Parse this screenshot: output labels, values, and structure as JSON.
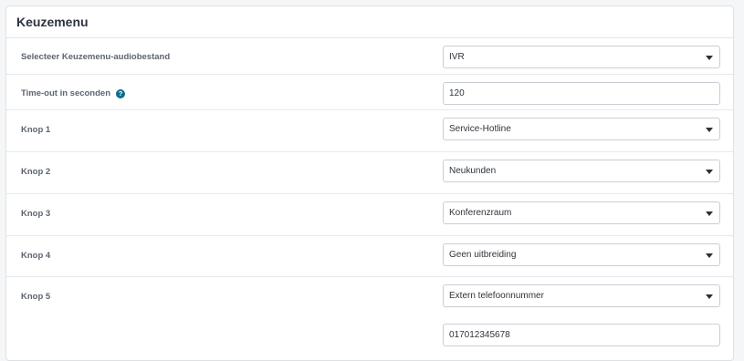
{
  "panel": {
    "title": "Keuzemenu"
  },
  "rows": [
    {
      "label": "Selecteer Keuzemenu-audiobestand",
      "value": "IVR",
      "kind": "select"
    },
    {
      "label": "Time-out in seconden",
      "value": "120",
      "kind": "input",
      "help_icon": "question-icon"
    },
    {
      "label": "Knop 1",
      "value": "Service-Hotline",
      "kind": "select"
    },
    {
      "label": "Knop 2",
      "value": "Neukunden",
      "kind": "select"
    },
    {
      "label": "Knop 3",
      "value": "Konferenzraum",
      "kind": "select"
    },
    {
      "label": "Knop 4",
      "value": "Geen uitbreiding",
      "kind": "select"
    },
    {
      "label": "Knop 5",
      "value": "Extern telefoonnummer",
      "kind": "select",
      "extra_input": "017012345678"
    }
  ],
  "colors": {
    "help_icon": "#0f6d8a"
  }
}
